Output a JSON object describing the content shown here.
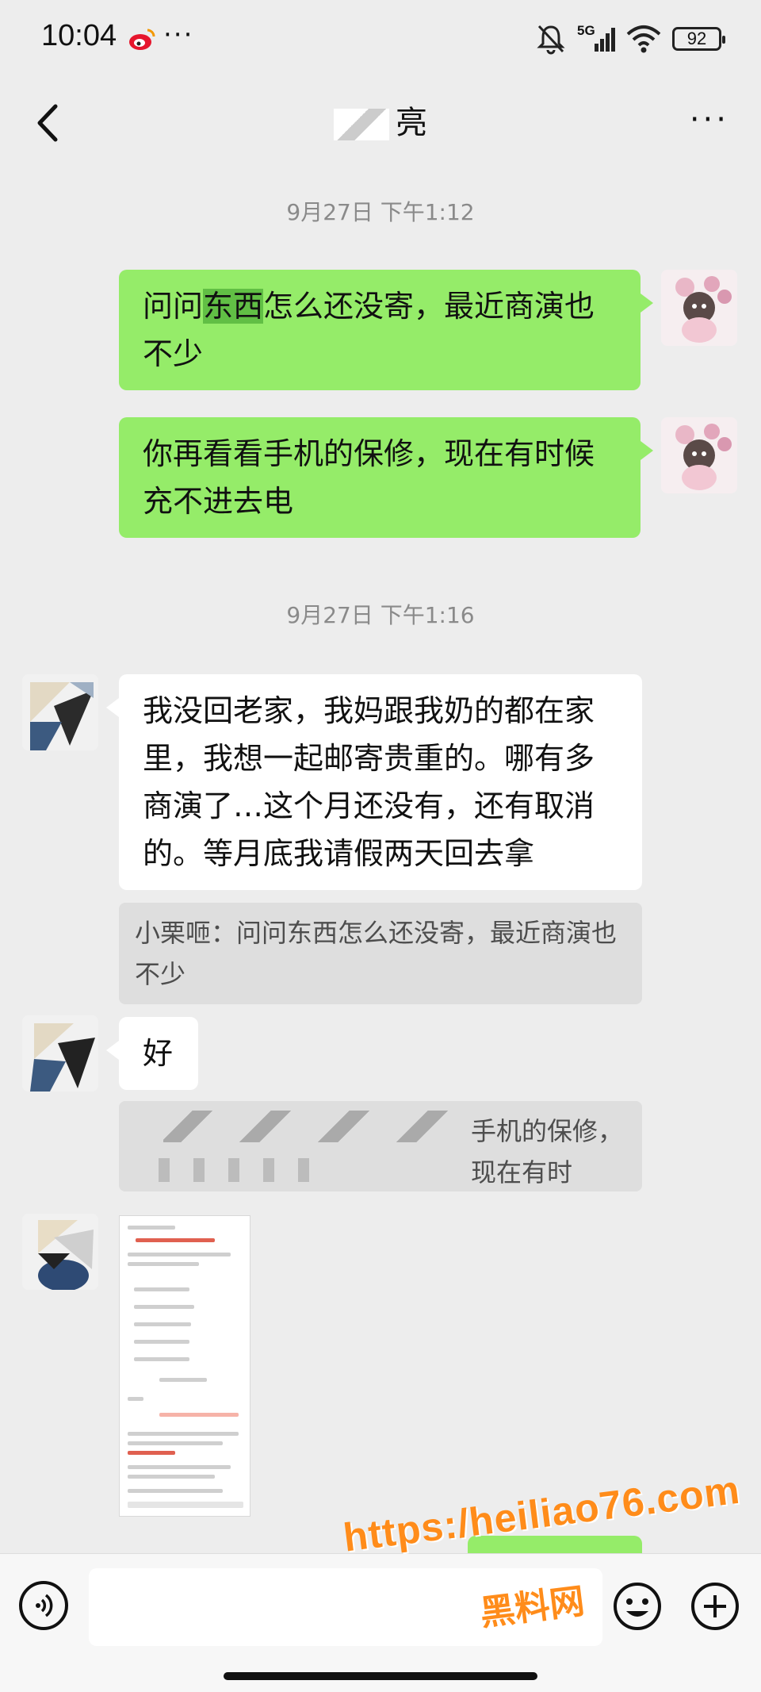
{
  "status_bar": {
    "time": "10:04",
    "more": "···",
    "network": "5G",
    "battery": "92"
  },
  "nav": {
    "title": "亮",
    "more": "···"
  },
  "timestamps": [
    "9月27日 下午1:12",
    "9月27日 下午1:16"
  ],
  "messages": [
    {
      "side": "right",
      "pre": "问问",
      "highlight": "东西",
      "post": "怎么还没寄，最近商演也不少"
    },
    {
      "side": "right",
      "text": "你再看看手机的保修，现在有时候充不进去电"
    },
    {
      "side": "left",
      "text": "我没回老家，我妈跟我奶的都在家里，我想一起邮寄贵重的。哪有多商演了…这个月还没有，还有取消的。等月底我请假两天回去拿",
      "quote": "小栗咂：问问东西怎么还没寄，最近商演也不少"
    },
    {
      "side": "left",
      "text": "好",
      "quote": "手机的保修，现在有时"
    }
  ],
  "watermark": {
    "url": "https:/heiliao76.com",
    "name": "黑料网"
  },
  "colors": {
    "background": "#ededed",
    "bubble_right": "#95ec69",
    "bubble_left": "#ffffff",
    "quote_bg": "#dedede",
    "watermark": "#ff8c1a"
  }
}
